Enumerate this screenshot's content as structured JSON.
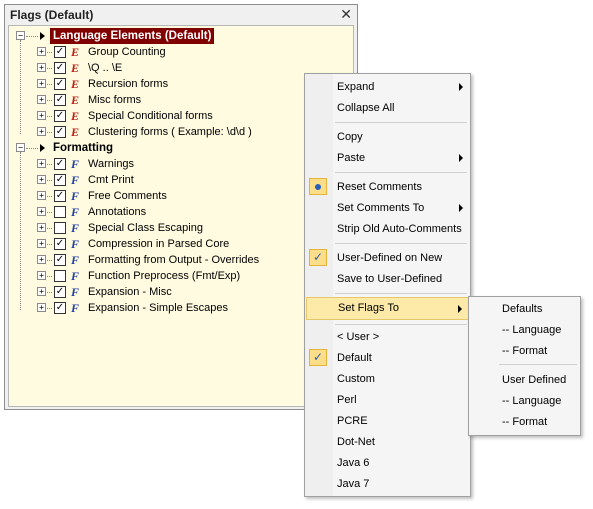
{
  "panel": {
    "title": "Flags  (Default)",
    "close_glyph": "✕"
  },
  "tree": {
    "language_group": {
      "label": "Language Elements  (Default)",
      "items": [
        {
          "label": "Group Counting",
          "checked": true,
          "icon": "E"
        },
        {
          "label": "\\Q .. \\E",
          "checked": true,
          "icon": "E"
        },
        {
          "label": "Recursion forms",
          "checked": true,
          "icon": "E"
        },
        {
          "label": "Misc forms",
          "checked": true,
          "icon": "E"
        },
        {
          "label": "Special Conditional forms",
          "checked": true,
          "icon": "E"
        },
        {
          "label": "Clustering forms  ( Example:  \\d\\d )",
          "checked": true,
          "icon": "E"
        }
      ]
    },
    "formatting_group": {
      "label": "Formatting",
      "items": [
        {
          "label": "Warnings",
          "checked": true,
          "icon": "F"
        },
        {
          "label": "Cmt Print",
          "checked": true,
          "icon": "F"
        },
        {
          "label": "Free Comments",
          "checked": true,
          "icon": "F"
        },
        {
          "label": "Annotations",
          "checked": false,
          "icon": "F"
        },
        {
          "label": "Special Class Escaping",
          "checked": false,
          "icon": "F"
        },
        {
          "label": "Compression in Parsed Core",
          "checked": true,
          "icon": "F"
        },
        {
          "label": "Formatting from Output - Overrides",
          "checked": true,
          "icon": "F"
        },
        {
          "label": "Function Preprocess (Fmt/Exp)",
          "checked": false,
          "icon": "F"
        },
        {
          "label": "Expansion - Misc",
          "checked": true,
          "icon": "F"
        },
        {
          "label": "Expansion - Simple Escapes",
          "checked": true,
          "icon": "F"
        }
      ]
    }
  },
  "context_menu": {
    "expand": "Expand",
    "collapse_all": "Collapse All",
    "copy": "Copy",
    "paste": "Paste",
    "reset_comments": "Reset  Comments",
    "set_comments_to": "Set  Comments To",
    "strip_old_auto_comments": "Strip Old Auto-Comments",
    "user_defined_on_new": "User-Defined on New",
    "save_to_user_defined": "Save to User-Defined",
    "set_flags_to": "Set  Flags To",
    "user": "< User >",
    "default": "Default",
    "custom": "Custom",
    "perl": "Perl",
    "pcre": "PCRE",
    "dotnet": "Dot-Net",
    "java6": "Java 6",
    "java7": "Java 7"
  },
  "submenu": {
    "defaults": "Defaults",
    "defaults_language": "--  Language",
    "defaults_format": "--  Format",
    "user_defined": "User Defined",
    "user_language": "--  Language",
    "user_format": "--  Format"
  },
  "colors": {
    "tree_bg": "#fffbe0",
    "group_highlight": "#800000",
    "e_icon": "#c0201a",
    "f_icon": "#1f3fa6",
    "menu_highlight": "#fde9a8"
  }
}
